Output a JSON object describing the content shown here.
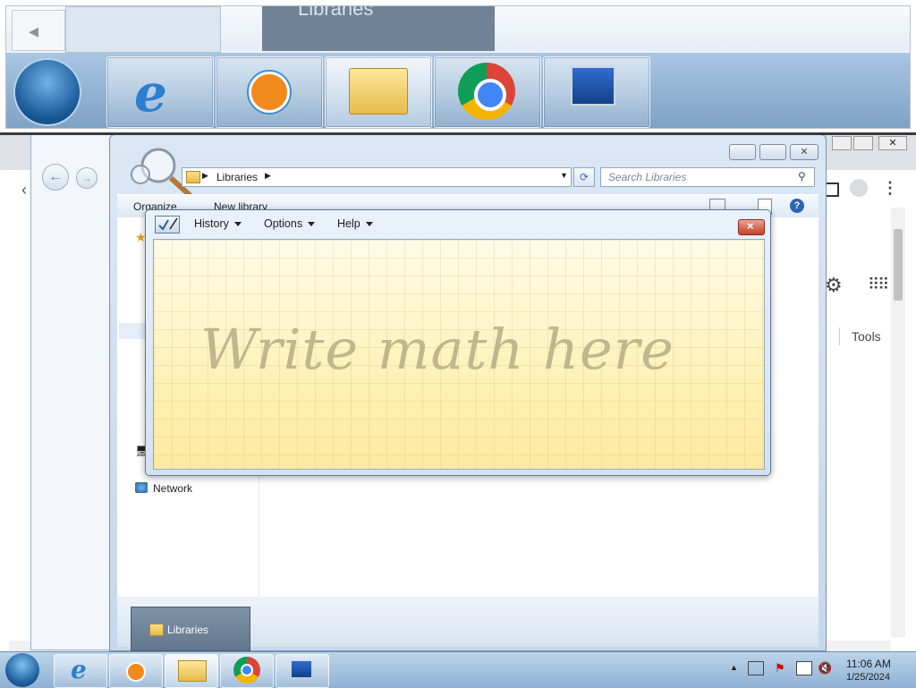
{
  "magnifier": {
    "window_title": "Libraries"
  },
  "explorer": {
    "address": "Libraries",
    "search_placeholder": "Search Libraries",
    "organize": "Organize",
    "new_library": "New library",
    "nav_network": "Network",
    "thumbnail_label": "Libraries"
  },
  "chrome": {
    "tools": "Tools"
  },
  "math_panel": {
    "menus": [
      "History",
      "Options",
      "Help"
    ],
    "hint": "Write math here",
    "close": "×"
  },
  "taskbar": {
    "apps": [
      "internet-explorer",
      "windows-media-player",
      "windows-explorer",
      "google-chrome",
      "magnifier"
    ],
    "time": "11:06 AM",
    "date": "1/25/2024"
  }
}
